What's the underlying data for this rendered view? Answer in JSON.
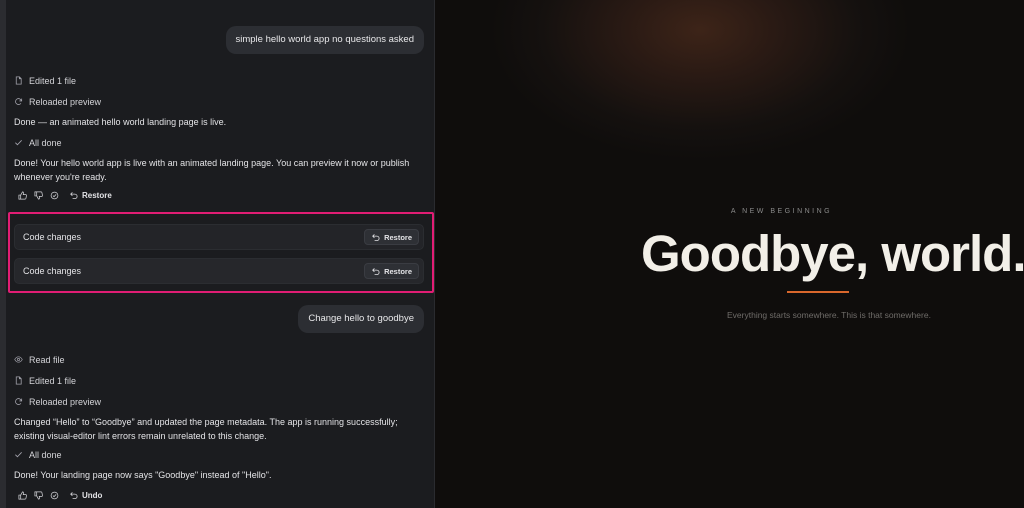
{
  "chat": {
    "messages": {
      "user1": "simple hello world app no questions asked",
      "edited1": "Edited 1 file",
      "reloaded1": "Reloaded preview",
      "status1": "Done — an animated hello world landing page is live.",
      "alldone1": "All done",
      "reply1": "Done! Your hello world app is live with an animated landing page. You can preview it now or publish whenever you're ready.",
      "restore_action": "Restore",
      "code_changes_1": "Code changes",
      "code_changes_2": "Code changes",
      "restore_btn_1": "Restore",
      "restore_btn_2": "Restore",
      "user2": "Change hello to goodbye",
      "readfile": "Read file",
      "edited2": "Edited 1 file",
      "reloaded2": "Reloaded preview",
      "status2": "Changed “Hello” to “Goodbye” and updated the page metadata. The app is running successfully; existing visual-editor lint errors remain unrelated to this change.",
      "alldone2": "All done",
      "reply2": "Done! Your landing page now says \"Goodbye\" instead of \"Hello\".",
      "undo_action": "Undo"
    }
  },
  "preview": {
    "eyebrow": "A NEW BEGINNING",
    "headline": "Goodbye, world.",
    "tagline": "Everything starts somewhere. This is that somewhere."
  },
  "colors": {
    "highlight": "#e11d74",
    "accent": "#d9672c",
    "background": "#1b1c1f"
  },
  "icons": [
    "file-icon",
    "refresh-icon",
    "check-icon",
    "thumbs-up-icon",
    "thumbs-down-icon",
    "verify-icon",
    "restore-icon",
    "eye-icon",
    "undo-icon"
  ]
}
